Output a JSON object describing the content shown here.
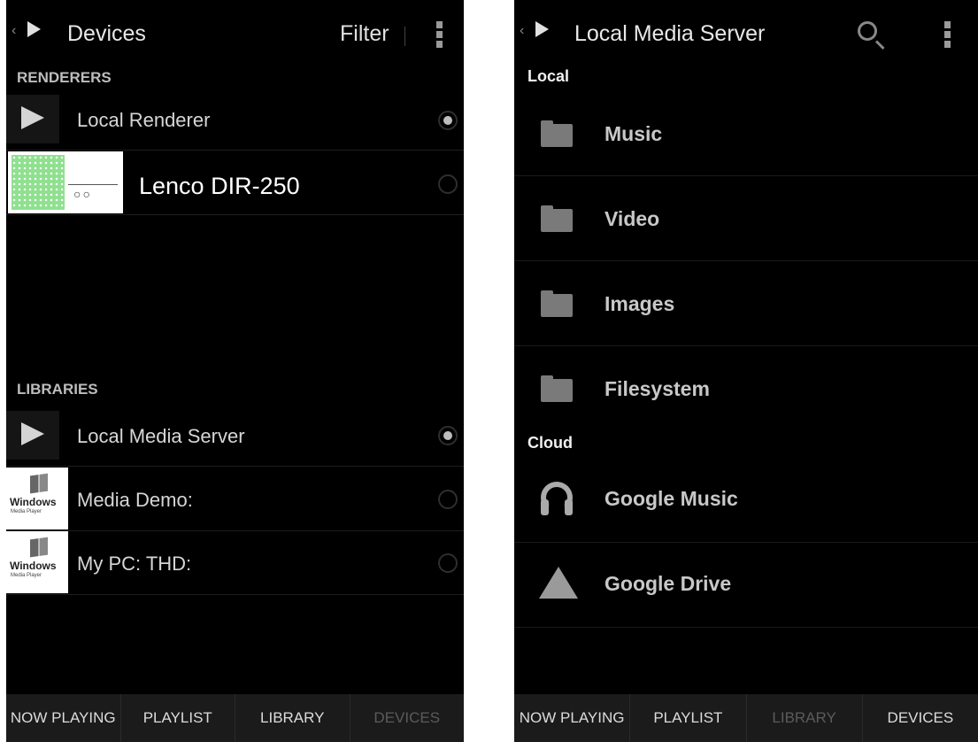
{
  "left": {
    "actionbar": {
      "back": "‹",
      "title": "Devices",
      "filter": "Filter"
    },
    "renderers": {
      "header": "RENDERERS",
      "items": [
        {
          "label": "Local Renderer",
          "selected": true
        },
        {
          "label": "Lenco DIR-250",
          "selected": false
        }
      ]
    },
    "libraries": {
      "header": "LIBRARIES",
      "items": [
        {
          "label": "Local Media Server",
          "selected": true
        },
        {
          "label": "Media Demo:",
          "selected": false
        },
        {
          "label": "My PC:  THD:",
          "selected": false
        }
      ],
      "wmp_logo": {
        "text1": "Windows",
        "text2": "Media Player"
      }
    },
    "tabs": [
      {
        "label": "NOW PLAYING",
        "active": true
      },
      {
        "label": "PLAYLIST",
        "active": true
      },
      {
        "label": "LIBRARY",
        "active": true
      },
      {
        "label": "DEVICES",
        "active": false
      }
    ]
  },
  "right": {
    "actionbar": {
      "back": "‹",
      "title": "Local Media Server"
    },
    "local": {
      "header": "Local",
      "items": [
        "Music",
        "Video",
        "Images",
        "Filesystem"
      ]
    },
    "cloud": {
      "header": "Cloud",
      "items": [
        "Google Music",
        "Google Drive"
      ]
    },
    "tabs": [
      {
        "label": "NOW PLAYING",
        "active": true
      },
      {
        "label": "PLAYLIST",
        "active": true
      },
      {
        "label": "LIBRARY",
        "active": false
      },
      {
        "label": "DEVICES",
        "active": true
      }
    ]
  },
  "colors": {
    "background": "#000000",
    "text": "#d6d6d6",
    "tab_bar": "#1b1b1b",
    "tab_disabled": "#5b5b5b"
  }
}
